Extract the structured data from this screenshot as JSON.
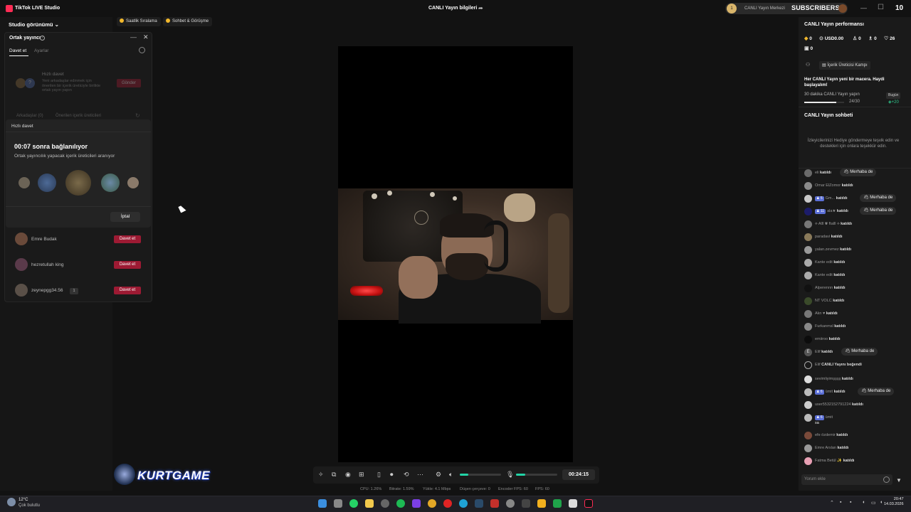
{
  "titlebar": {
    "app_title": "TikTok LIVE Studio",
    "center_title": "CANLI Yayın bilgileri",
    "creator_center": "CANLI Yayın Merkezi",
    "badge_level": "1",
    "subscribers_label": "SUBSCRIBERS",
    "count": "10"
  },
  "left": {
    "studio_view": "Studio görünümü",
    "chips": [
      "Saatlik Sıralama",
      "Sohbet & Görüşme"
    ]
  },
  "cohost": {
    "title": "Ortak yayıncı",
    "tabs": [
      "Davet et",
      "Ayarlar"
    ],
    "quick_invite": {
      "heading": "Hızlı davet",
      "description": "Yeni arkadaşlar edinmek için önerilen bir içerik üreticiyle birlikte ortak yayın yapın",
      "send": "Gönder"
    },
    "sub_tabs": [
      "Arkadaşlar (0)",
      "Önerilen içerik üreticileri"
    ],
    "popup": {
      "header": "Hızlı davet",
      "timer_text": "00:07 sonra bağlanılıyor",
      "subtitle": "Ortak yayıncılık yapacak içerik üreticileri aranıyor",
      "cancel": "İptal"
    },
    "friends": [
      {
        "name": "Emre Budak",
        "action": "Davet et"
      },
      {
        "name": "hezretullah king",
        "action": "Davet et"
      },
      {
        "name": "zeynepgg34.56",
        "badge": "1",
        "action": "Davet et"
      }
    ]
  },
  "toolbar": {
    "timer": "00:24:15",
    "mic_level": 0.22,
    "volume_level": 0.2
  },
  "stats": {
    "cpu": "CPU: 1.26%",
    "bitrate": "Bitrate: 1.59%",
    "upload": "Yükle: 4.1 Mbps",
    "dropped": "Düşen çerçeve: 0",
    "encoder_fps": "Encoder FPS: 60",
    "fps": "FPS: 60"
  },
  "watermark": "KURTGAME",
  "right": {
    "perf_title": "CANLI Yayın performansı",
    "stats": [
      "0",
      "USD0.00",
      "0",
      "0",
      "26",
      "0"
    ],
    "campaign_button": "İçerik Üreticisi Kampı",
    "headline": "Her CANLI Yayın yeni bir macera. Haydi başlayalım!",
    "task": "30 dakika CANLI Yayın yapın",
    "today": "Bugün",
    "progress_text": "24/30",
    "progress": 0.8,
    "reward": "+20",
    "chat_title": "CANLI Yayın sohbeti",
    "chat_prompt": "İzleyicilerinizi Hediye göndermeye teşvik edin ve destekleri için onlara teşekkür edin.",
    "chat_input_placeholder": "Yorum ekle"
  },
  "chat": [
    {
      "user": "eli",
      "text": "katıldı",
      "hello": "Merhaba de",
      "color": "#6a6a6a"
    },
    {
      "user": "Omar ElZomor",
      "text": "katıldı",
      "color": "#8a8a8a"
    },
    {
      "user": "Gm...",
      "level": "5",
      "text": "katıldı",
      "hello": "Merhaba de",
      "color": "#c9c9c9"
    },
    {
      "user": "ala★",
      "level": "11",
      "text": "katıldı",
      "hello": "Merhaba de",
      "color": "#1c1c6a"
    },
    {
      "user": "⟡ Alll ♛ ftalll ⟡",
      "text": "katıldı",
      "color": "#777"
    },
    {
      "user": "paradavi",
      "text": "katıldı",
      "color": "#8a7a5a"
    },
    {
      "user": "yalan.zevmez",
      "text": "katıldı",
      "color": "#999"
    },
    {
      "user": "Kante edit",
      "text": "katıldı",
      "color": "#aaa"
    },
    {
      "user": "Kante edit",
      "text": "katıldı",
      "color": "#aaa"
    },
    {
      "user": "Alperennn",
      "text": "katıldı",
      "color": "#111"
    },
    {
      "user": "NT VOLC",
      "text": "katıldı",
      "color": "#3a4a2a"
    },
    {
      "user": "Akn ♥",
      "text": "katıldı",
      "color": "#777"
    },
    {
      "user": "Furkanmsl",
      "text": "katıldı",
      "color": "#888"
    },
    {
      "user": "emiiroo",
      "text": "katıldı",
      "color": "#0c0c0c"
    },
    {
      "user": "Elif",
      "text": "katıldı",
      "hello": "Merhaba de",
      "color": "#555",
      "initial": "E"
    },
    {
      "user": "Elif",
      "text": "CANLI Yayını beğendi",
      "color": "#333",
      "heart": true
    },
    {
      "user": "sevimliyimşşşş",
      "text": "katıldı",
      "color": "#ddd"
    },
    {
      "user": "ümit",
      "level": "6",
      "text": "katıldı",
      "hello": "Merhaba de",
      "color": "#bbb"
    },
    {
      "user": "user5532152791224",
      "text": "katıldı",
      "color": "#ccc"
    },
    {
      "user": "ümit",
      "level": "6",
      "text": "",
      "message": "sa",
      "color": "#bbb"
    },
    {
      "user": "efe özdemir",
      "text": "katıldı",
      "color": "#7a4a3a"
    },
    {
      "user": "Emre Arslan",
      "text": "katıldı",
      "color": "#999"
    },
    {
      "user": "Fatma Betül ✨",
      "text": "katıldı",
      "color": "#e8a0b4"
    }
  ],
  "taskbar": {
    "temp": "12°C",
    "weather": "Çok bulutlu",
    "time": "20:47",
    "date": "14.03.2026"
  }
}
